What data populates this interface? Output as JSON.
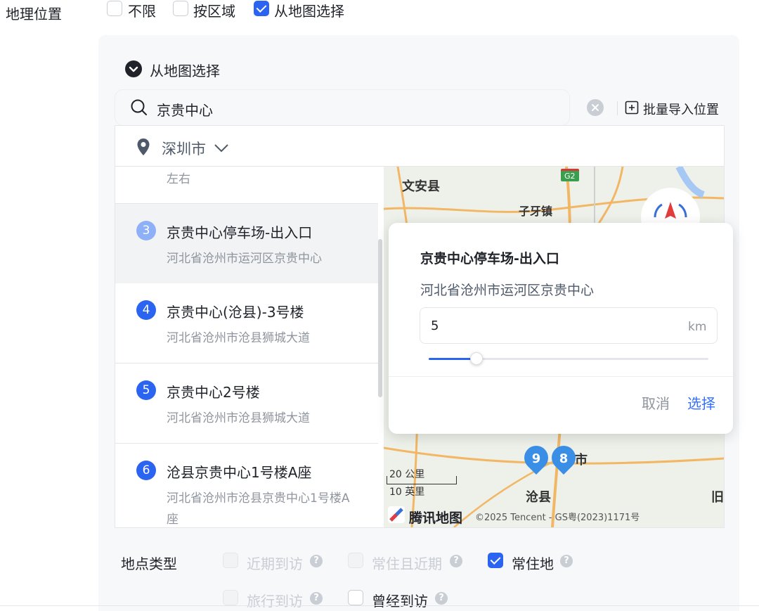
{
  "geo": {
    "label": "地理位置",
    "options": [
      {
        "label": "不限",
        "checked": false
      },
      {
        "label": "按区域",
        "checked": false
      },
      {
        "label": "从地图选择",
        "checked": true
      }
    ]
  },
  "section": {
    "title": "从地图选择"
  },
  "search": {
    "value": "京贵中心",
    "bulk_import": "批量导入位置"
  },
  "city": {
    "name": "深圳市"
  },
  "results": {
    "partial_addr": "左右",
    "items": [
      {
        "num": "3",
        "title": "京贵中心停车场-出入口",
        "addr": "河北省沧州市运河区京贵中心"
      },
      {
        "num": "4",
        "title": "京贵中心(沧县)-3号楼",
        "addr": "河北省沧州市沧县狮城大道"
      },
      {
        "num": "5",
        "title": "京贵中心2号楼",
        "addr": "河北省沧州市沧县狮城大道"
      },
      {
        "num": "6",
        "title": "沧县京贵中心1号楼A座",
        "addr": "河北省沧州市沧县京贵中心1号楼A",
        "addr2": "座"
      }
    ]
  },
  "map": {
    "labels": {
      "wenan": "文安县",
      "ziya": "子牙镇",
      "cangxian": "沧县",
      "jiu": "旧",
      "shi": "市"
    },
    "badges": {
      "g2": "G2"
    },
    "pins": [
      "9",
      "8"
    ],
    "scale": {
      "km": "20 公里",
      "mi": "10 英里"
    },
    "logo": "腾讯地图",
    "copyright": "©2025 Tencent - GS粤(2023)1171号"
  },
  "popup": {
    "title": "京贵中心停车场-出入口",
    "addr": "河北省沧州市运河区京贵中心",
    "radius_value": "5",
    "radius_unit": "km",
    "slider_fraction": 0.17,
    "cancel": "取消",
    "select": "选择"
  },
  "place_type": {
    "label": "地点类型",
    "options": [
      {
        "label": "近期到访",
        "checked": false,
        "disabled": true
      },
      {
        "label": "常住且近期",
        "checked": false,
        "disabled": true
      },
      {
        "label": "常住地",
        "checked": true,
        "disabled": false
      },
      {
        "label": "旅行到访",
        "checked": false,
        "disabled": true
      },
      {
        "label": "曾经到访",
        "checked": false,
        "disabled": false
      }
    ]
  },
  "colors": {
    "accent": "#2b64f0",
    "link": "#3370ff",
    "muted": "#8f959e"
  }
}
